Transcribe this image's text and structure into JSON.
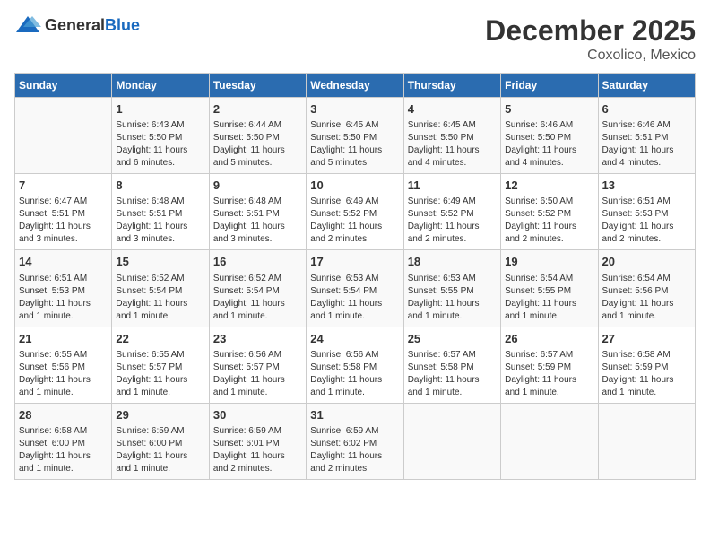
{
  "logo": {
    "general": "General",
    "blue": "Blue"
  },
  "title": "December 2025",
  "location": "Coxolico, Mexico",
  "days_of_week": [
    "Sunday",
    "Monday",
    "Tuesday",
    "Wednesday",
    "Thursday",
    "Friday",
    "Saturday"
  ],
  "weeks": [
    [
      {
        "day": "",
        "info": ""
      },
      {
        "day": "1",
        "info": "Sunrise: 6:43 AM\nSunset: 5:50 PM\nDaylight: 11 hours\nand 6 minutes."
      },
      {
        "day": "2",
        "info": "Sunrise: 6:44 AM\nSunset: 5:50 PM\nDaylight: 11 hours\nand 5 minutes."
      },
      {
        "day": "3",
        "info": "Sunrise: 6:45 AM\nSunset: 5:50 PM\nDaylight: 11 hours\nand 5 minutes."
      },
      {
        "day": "4",
        "info": "Sunrise: 6:45 AM\nSunset: 5:50 PM\nDaylight: 11 hours\nand 4 minutes."
      },
      {
        "day": "5",
        "info": "Sunrise: 6:46 AM\nSunset: 5:50 PM\nDaylight: 11 hours\nand 4 minutes."
      },
      {
        "day": "6",
        "info": "Sunrise: 6:46 AM\nSunset: 5:51 PM\nDaylight: 11 hours\nand 4 minutes."
      }
    ],
    [
      {
        "day": "7",
        "info": "Sunrise: 6:47 AM\nSunset: 5:51 PM\nDaylight: 11 hours\nand 3 minutes."
      },
      {
        "day": "8",
        "info": "Sunrise: 6:48 AM\nSunset: 5:51 PM\nDaylight: 11 hours\nand 3 minutes."
      },
      {
        "day": "9",
        "info": "Sunrise: 6:48 AM\nSunset: 5:51 PM\nDaylight: 11 hours\nand 3 minutes."
      },
      {
        "day": "10",
        "info": "Sunrise: 6:49 AM\nSunset: 5:52 PM\nDaylight: 11 hours\nand 2 minutes."
      },
      {
        "day": "11",
        "info": "Sunrise: 6:49 AM\nSunset: 5:52 PM\nDaylight: 11 hours\nand 2 minutes."
      },
      {
        "day": "12",
        "info": "Sunrise: 6:50 AM\nSunset: 5:52 PM\nDaylight: 11 hours\nand 2 minutes."
      },
      {
        "day": "13",
        "info": "Sunrise: 6:51 AM\nSunset: 5:53 PM\nDaylight: 11 hours\nand 2 minutes."
      }
    ],
    [
      {
        "day": "14",
        "info": "Sunrise: 6:51 AM\nSunset: 5:53 PM\nDaylight: 11 hours\nand 1 minute."
      },
      {
        "day": "15",
        "info": "Sunrise: 6:52 AM\nSunset: 5:54 PM\nDaylight: 11 hours\nand 1 minute."
      },
      {
        "day": "16",
        "info": "Sunrise: 6:52 AM\nSunset: 5:54 PM\nDaylight: 11 hours\nand 1 minute."
      },
      {
        "day": "17",
        "info": "Sunrise: 6:53 AM\nSunset: 5:54 PM\nDaylight: 11 hours\nand 1 minute."
      },
      {
        "day": "18",
        "info": "Sunrise: 6:53 AM\nSunset: 5:55 PM\nDaylight: 11 hours\nand 1 minute."
      },
      {
        "day": "19",
        "info": "Sunrise: 6:54 AM\nSunset: 5:55 PM\nDaylight: 11 hours\nand 1 minute."
      },
      {
        "day": "20",
        "info": "Sunrise: 6:54 AM\nSunset: 5:56 PM\nDaylight: 11 hours\nand 1 minute."
      }
    ],
    [
      {
        "day": "21",
        "info": "Sunrise: 6:55 AM\nSunset: 5:56 PM\nDaylight: 11 hours\nand 1 minute."
      },
      {
        "day": "22",
        "info": "Sunrise: 6:55 AM\nSunset: 5:57 PM\nDaylight: 11 hours\nand 1 minute."
      },
      {
        "day": "23",
        "info": "Sunrise: 6:56 AM\nSunset: 5:57 PM\nDaylight: 11 hours\nand 1 minute."
      },
      {
        "day": "24",
        "info": "Sunrise: 6:56 AM\nSunset: 5:58 PM\nDaylight: 11 hours\nand 1 minute."
      },
      {
        "day": "25",
        "info": "Sunrise: 6:57 AM\nSunset: 5:58 PM\nDaylight: 11 hours\nand 1 minute."
      },
      {
        "day": "26",
        "info": "Sunrise: 6:57 AM\nSunset: 5:59 PM\nDaylight: 11 hours\nand 1 minute."
      },
      {
        "day": "27",
        "info": "Sunrise: 6:58 AM\nSunset: 5:59 PM\nDaylight: 11 hours\nand 1 minute."
      }
    ],
    [
      {
        "day": "28",
        "info": "Sunrise: 6:58 AM\nSunset: 6:00 PM\nDaylight: 11 hours\nand 1 minute."
      },
      {
        "day": "29",
        "info": "Sunrise: 6:59 AM\nSunset: 6:00 PM\nDaylight: 11 hours\nand 1 minute."
      },
      {
        "day": "30",
        "info": "Sunrise: 6:59 AM\nSunset: 6:01 PM\nDaylight: 11 hours\nand 2 minutes."
      },
      {
        "day": "31",
        "info": "Sunrise: 6:59 AM\nSunset: 6:02 PM\nDaylight: 11 hours\nand 2 minutes."
      },
      {
        "day": "",
        "info": ""
      },
      {
        "day": "",
        "info": ""
      },
      {
        "day": "",
        "info": ""
      }
    ]
  ]
}
